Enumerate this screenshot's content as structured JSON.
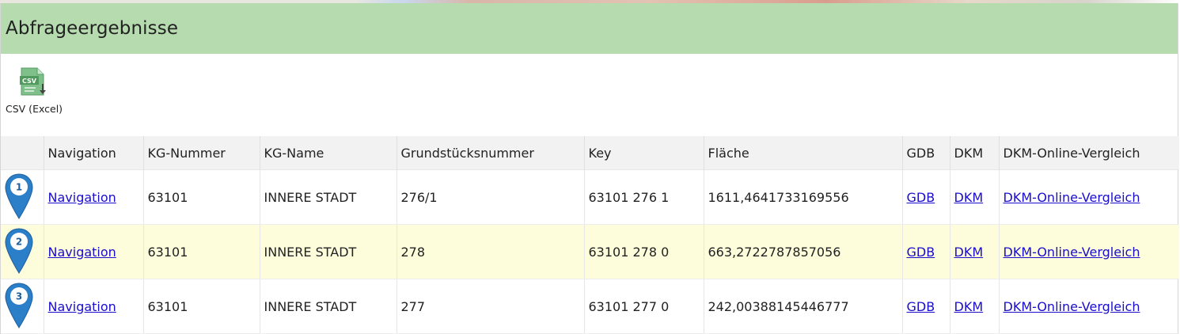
{
  "panel": {
    "title": "Abfrageergebnisse"
  },
  "toolbar": {
    "csv_label": "CSV (Excel)",
    "csv_icon_text": "CSV"
  },
  "colors": {
    "header_bg": "#b5dbae",
    "alt_row_bg": "#fdfddc",
    "link": "#1a0dcc",
    "pin_blue": "#2b7fc8"
  },
  "table": {
    "columns": [
      "",
      "Navigation",
      "KG-Nummer",
      "KG-Name",
      "Grundstücksnummer",
      "Key",
      "Fläche",
      "GDB",
      "DKM",
      "DKM-Online-Vergleich"
    ],
    "rows": [
      {
        "marker": "1",
        "navigation": "Navigation",
        "kg_nummer": "63101",
        "kg_name": "INNERE STADT",
        "grundstuecksnummer": "276/1",
        "key": "63101 276 1",
        "flaeche": "1611,4641733169556",
        "gdb": "GDB",
        "dkm": "DKM",
        "dkm_online": "DKM-Online-Vergleich"
      },
      {
        "marker": "2",
        "navigation": "Navigation",
        "kg_nummer": "63101",
        "kg_name": "INNERE STADT",
        "grundstuecksnummer": "278",
        "key": "63101 278 0",
        "flaeche": "663,2722787857056",
        "gdb": "GDB",
        "dkm": "DKM",
        "dkm_online": "DKM-Online-Vergleich"
      },
      {
        "marker": "3",
        "navigation": "Navigation",
        "kg_nummer": "63101",
        "kg_name": "INNERE STADT",
        "grundstuecksnummer": "277",
        "key": "63101 277 0",
        "flaeche": "242,00388145446777",
        "gdb": "GDB",
        "dkm": "DKM",
        "dkm_online": "DKM-Online-Vergleich"
      }
    ]
  }
}
